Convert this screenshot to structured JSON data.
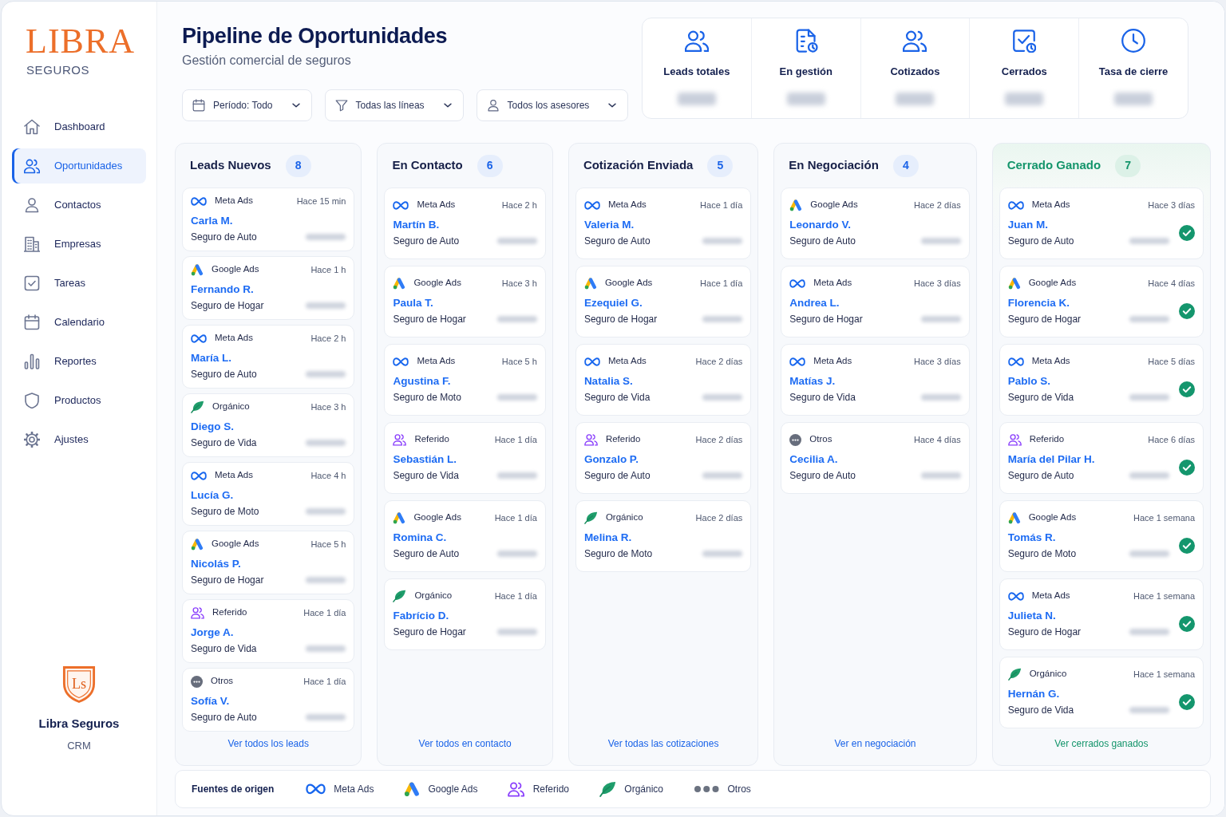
{
  "sidebar": {
    "logo": {
      "brand": "LIBRA",
      "tagline": "SEGUROS"
    },
    "items": [
      {
        "label": "Dashboard",
        "selected": false
      },
      {
        "label": "Oportunidades",
        "selected": true
      },
      {
        "label": "Contactos",
        "selected": false
      },
      {
        "label": "Empresas",
        "selected": false
      },
      {
        "label": "Tareas",
        "selected": false
      },
      {
        "label": "Calendario",
        "selected": false
      },
      {
        "label": "Reportes",
        "selected": false
      },
      {
        "label": "Productos",
        "selected": false
      },
      {
        "label": "Ajustes",
        "selected": false
      }
    ],
    "footer": {
      "emblem": "Ls",
      "name": "Libra Seguros",
      "subtitle": "CRM"
    }
  },
  "header": {
    "title": "Pipeline de Oportunidades",
    "subtitle": "Gestión comercial de seguros"
  },
  "filters": [
    {
      "label": "Período: Todo"
    },
    {
      "label": "Todas las líneas"
    },
    {
      "label": "Todos los asesores"
    }
  ],
  "stats": [
    {
      "label": "Leads totales"
    },
    {
      "label": "En gestión"
    },
    {
      "label": "Cotizados"
    },
    {
      "label": "Cerrados"
    },
    {
      "label": "Tasa de cierre"
    }
  ],
  "columns": [
    {
      "title": "Leads Nuevos",
      "count": "8",
      "kind": "open",
      "link": "Ver todos los leads",
      "cards": [
        {
          "kind": "meta",
          "source": "Meta Ads",
          "time": "Hace 15 min",
          "name": "Carla M.",
          "product": "Seguro de Auto"
        },
        {
          "kind": "google",
          "source": "Google Ads",
          "time": "Hace 1 h",
          "name": "Fernando R.",
          "product": "Seguro de Hogar"
        },
        {
          "kind": "meta",
          "source": "Meta Ads",
          "time": "Hace 2 h",
          "name": "María L.",
          "product": "Seguro de Auto"
        },
        {
          "kind": "organic",
          "source": "Orgánico",
          "time": "Hace 3 h",
          "name": "Diego S.",
          "product": "Seguro de Vida"
        },
        {
          "kind": "meta",
          "source": "Meta Ads",
          "time": "Hace 4 h",
          "name": "Lucía G.",
          "product": "Seguro de Moto"
        },
        {
          "kind": "google",
          "source": "Google Ads",
          "time": "Hace 5 h",
          "name": "Nicolás P.",
          "product": "Seguro de Hogar"
        },
        {
          "kind": "referral",
          "source": "Referido",
          "time": "Hace 1 día",
          "name": "Jorge A.",
          "product": "Seguro de Vida"
        },
        {
          "kind": "other",
          "source": "Otros",
          "time": "Hace 1 día",
          "name": "Sofía V.",
          "product": "Seguro de Auto"
        }
      ]
    },
    {
      "title": "En Contacto",
      "count": "6",
      "kind": "open",
      "link": "Ver todos en contacto",
      "cards": [
        {
          "kind": "meta",
          "source": "Meta Ads",
          "time": "Hace 2 h",
          "name": "Martín B.",
          "product": "Seguro de Auto"
        },
        {
          "kind": "google",
          "source": "Google Ads",
          "time": "Hace 3 h",
          "name": "Paula T.",
          "product": "Seguro de Hogar"
        },
        {
          "kind": "meta",
          "source": "Meta Ads",
          "time": "Hace 5 h",
          "name": "Agustina F.",
          "product": "Seguro de Moto"
        },
        {
          "kind": "referral",
          "source": "Referido",
          "time": "Hace 1 día",
          "name": "Sebastián L.",
          "product": "Seguro de Vida"
        },
        {
          "kind": "google",
          "source": "Google Ads",
          "time": "Hace 1 día",
          "name": "Romina C.",
          "product": "Seguro de Auto"
        },
        {
          "kind": "organic",
          "source": "Orgánico",
          "time": "Hace 1 día",
          "name": "Fabrício D.",
          "product": "Seguro de Hogar"
        }
      ]
    },
    {
      "title": "Cotización Enviada",
      "count": "5",
      "kind": "open",
      "link": "Ver todas las cotizaciones",
      "cards": [
        {
          "kind": "meta",
          "source": "Meta Ads",
          "time": "Hace 1 día",
          "name": "Valeria M.",
          "product": "Seguro de Auto"
        },
        {
          "kind": "google",
          "source": "Google Ads",
          "time": "Hace 1 día",
          "name": "Ezequiel G.",
          "product": "Seguro de Hogar"
        },
        {
          "kind": "meta",
          "source": "Meta Ads",
          "time": "Hace 2 días",
          "name": "Natalia S.",
          "product": "Seguro de Vida"
        },
        {
          "kind": "referral",
          "source": "Referido",
          "time": "Hace 2 días",
          "name": "Gonzalo P.",
          "product": "Seguro de Auto"
        },
        {
          "kind": "organic",
          "source": "Orgánico",
          "time": "Hace 2 días",
          "name": "Melina R.",
          "product": "Seguro de Moto"
        }
      ]
    },
    {
      "title": "En Negociación",
      "count": "4",
      "kind": "open",
      "link": "Ver en negociación",
      "cards": [
        {
          "kind": "google",
          "source": "Google Ads",
          "time": "Hace 2 días",
          "name": "Leonardo V.",
          "product": "Seguro de Auto"
        },
        {
          "kind": "meta",
          "source": "Meta Ads",
          "time": "Hace 3 días",
          "name": "Andrea L.",
          "product": "Seguro de Hogar"
        },
        {
          "kind": "meta",
          "source": "Meta Ads",
          "time": "Hace 3 días",
          "name": "Matías J.",
          "product": "Seguro de Vida"
        },
        {
          "kind": "other",
          "source": "Otros",
          "time": "Hace 4 días",
          "name": "Cecilia A.",
          "product": "Seguro de Auto"
        }
      ]
    },
    {
      "title": "Cerrado Ganado",
      "count": "7",
      "kind": "won",
      "link": "Ver cerrados ganados",
      "cards": [
        {
          "kind": "meta",
          "source": "Meta Ads",
          "time": "Hace 3 días",
          "name": "Juan M.",
          "product": "Seguro de Auto"
        },
        {
          "kind": "google",
          "source": "Google Ads",
          "time": "Hace 4 días",
          "name": "Florencia K.",
          "product": "Seguro de Hogar"
        },
        {
          "kind": "meta",
          "source": "Meta Ads",
          "time": "Hace 5 días",
          "name": "Pablo S.",
          "product": "Seguro de Vida"
        },
        {
          "kind": "referral",
          "source": "Referido",
          "time": "Hace 6 días",
          "name": "María del Pilar H.",
          "product": "Seguro de Auto"
        },
        {
          "kind": "google",
          "source": "Google Ads",
          "time": "Hace 1 semana",
          "name": "Tomás R.",
          "product": "Seguro de Moto"
        },
        {
          "kind": "meta",
          "source": "Meta Ads",
          "time": "Hace 1 semana",
          "name": "Julieta N.",
          "product": "Seguro de Hogar"
        },
        {
          "kind": "organic",
          "source": "Orgánico",
          "time": "Hace 1 semana",
          "name": "Hernán G.",
          "product": "Seguro de Vida"
        }
      ]
    }
  ],
  "legend": {
    "title": "Fuentes de origen",
    "items": [
      {
        "kind": "meta",
        "label": "Meta Ads"
      },
      {
        "kind": "google",
        "label": "Google Ads"
      },
      {
        "kind": "referral",
        "label": "Referido"
      },
      {
        "kind": "organic",
        "label": "Orgánico"
      },
      {
        "kind": "other",
        "label": "Otros"
      }
    ]
  }
}
